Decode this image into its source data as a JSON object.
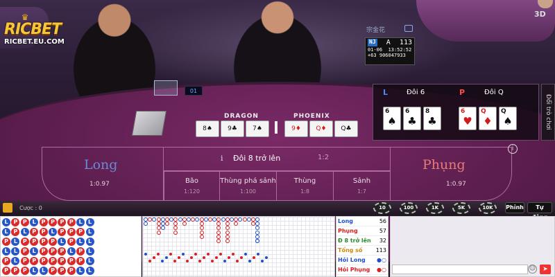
{
  "brand": {
    "name": "RICBET",
    "url": "RICBET.EU.COM"
  },
  "view_badge": "3D",
  "table_info": {
    "header": "宗金花",
    "game_code": "NJ",
    "table": "A",
    "round": "113",
    "date": "01-06",
    "time": "13:52:52",
    "phone": "+63 906047933"
  },
  "shoe_display": "01",
  "board": {
    "dragon_label": "DRAGON",
    "phoenix_label": "PHOENIX"
  },
  "dragon_cards": [
    "8♠",
    "9♣",
    "7♠"
  ],
  "phoenix_cards": [
    "9♦",
    "Q♦",
    "Q♣"
  ],
  "result": {
    "left_tag": "L",
    "left_title": "Đôi 6",
    "right_tag": "P",
    "right_title": "Đôi Q",
    "left_cards": [
      {
        "rank": "6",
        "suit": "♠",
        "color": "black"
      },
      {
        "rank": "6",
        "suit": "♣",
        "color": "black"
      },
      {
        "rank": "8",
        "suit": "♣",
        "color": "black"
      }
    ],
    "right_cards": [
      {
        "rank": "6",
        "suit": "♥",
        "color": "red"
      },
      {
        "rank": "Q",
        "suit": "♦",
        "color": "red"
      },
      {
        "rank": "Q",
        "suit": "♠",
        "color": "black"
      }
    ]
  },
  "side_tab": "Đổi trò chơi",
  "bets": {
    "long": {
      "label": "Long",
      "odds": "1:0.97"
    },
    "phung": {
      "label": "Phụng",
      "odds": "1:0.97"
    },
    "pair": {
      "icon": "i",
      "label": "Đôi 8 trở lên",
      "odds": "1:2"
    },
    "sub": [
      {
        "label": "Bão",
        "odds": "1:120"
      },
      {
        "label": "Thùng phá sảnh",
        "odds": "1:100"
      },
      {
        "label": "Thùng",
        "odds": "1:8"
      },
      {
        "label": "Sảnh",
        "odds": "1:7"
      }
    ]
  },
  "bet_total_label": "Cược : 0",
  "chips": [
    "10",
    "100",
    "1K",
    "5K",
    "10K"
  ],
  "controls": {
    "chips_btn": "Phỉnh",
    "auto_btn": "Tự động"
  },
  "bead_road": [
    [
      "L",
      "P",
      "P",
      "L",
      "P",
      "P",
      "P",
      "P",
      "L",
      "L"
    ],
    [
      "L",
      "P",
      "L",
      "P",
      "P",
      "L",
      "P",
      "P",
      "P",
      "L"
    ],
    [
      "P",
      "L",
      "P",
      "P",
      "P",
      "P",
      "L",
      "P",
      "L",
      "L"
    ],
    [
      "L",
      "L",
      "P",
      "L",
      "P",
      "P",
      "P",
      "L",
      "P",
      "L"
    ],
    [
      "P",
      "L",
      "P",
      "P",
      "P",
      "P",
      "P",
      "P",
      "P",
      "L"
    ],
    [
      "P",
      "P",
      "P",
      "L",
      "L",
      "P",
      "P",
      "P",
      "L",
      "L"
    ]
  ],
  "stats": [
    {
      "label": "Long",
      "value": "56",
      "color": "#2050c8"
    },
    {
      "label": "Phụng",
      "value": "57",
      "color": "#d82020"
    },
    {
      "label": "Đ 8 trở lên",
      "value": "32",
      "color": "#2a8a2a"
    },
    {
      "label": "Tổng số",
      "value": "113",
      "color": "#c88a10"
    },
    {
      "label": "Hỏi Long",
      "value": "",
      "color": "#2050c8"
    },
    {
      "label": "Hỏi Phụng",
      "value": "",
      "color": "#d82020"
    }
  ]
}
